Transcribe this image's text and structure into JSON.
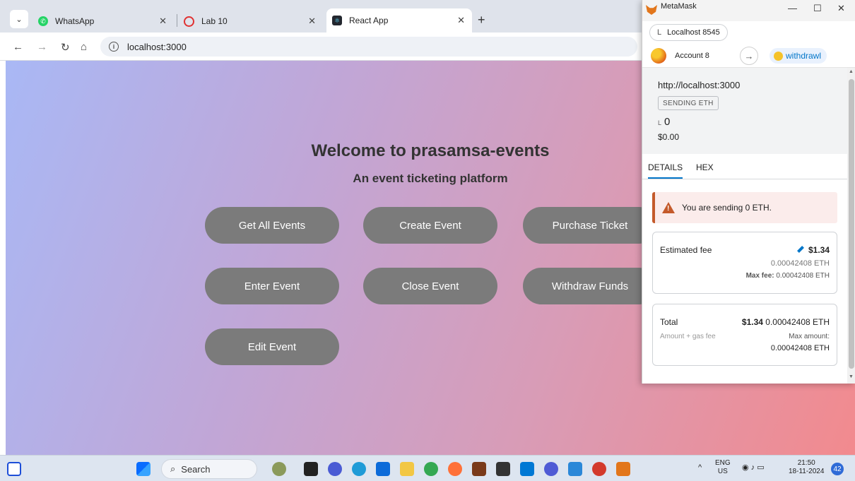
{
  "browser": {
    "tabs": [
      {
        "label": "WhatsApp",
        "icon": "whatsapp-icon"
      },
      {
        "label": "Lab 10",
        "icon": "lab-icon"
      },
      {
        "label": "React App",
        "icon": "react-icon"
      }
    ],
    "url": "localhost:3000"
  },
  "page": {
    "title": "Welcome to prasamsa-events",
    "subtitle": "An event ticketing platform",
    "buttons": [
      "Get All Events",
      "Create Event",
      "Purchase Ticket",
      "Enter Event",
      "Close Event",
      "Withdraw Funds",
      "Edit Event"
    ]
  },
  "metamask": {
    "window_title": "MetaMask",
    "network": "Localhost 8545",
    "network_prefix": "L",
    "account": "Account 8",
    "destination": "withdrawl",
    "origin": "http://localhost:3000",
    "badge": "SENDING ETH",
    "amount": "0",
    "amount_prefix": "L",
    "fiat": "$0.00",
    "tabs": [
      "DETAILS",
      "HEX"
    ],
    "warning": "You are sending 0 ETH.",
    "estimated_fee": {
      "label": "Estimated fee",
      "fiat": "$1.34",
      "eth": "0.00042408 ETH",
      "max_fee_label": "Max fee:",
      "max_fee": "0.00042408 ETH"
    },
    "total": {
      "label": "Total",
      "sub": "Amount + gas fee",
      "fiat": "$1.34",
      "eth": "0.00042408 ETH",
      "max_label": "Max amount:",
      "max": "0.00042408 ETH"
    }
  },
  "taskbar": {
    "search": "Search",
    "lang": "ENG",
    "region": "US",
    "time": "21:50",
    "date": "18-11-2024",
    "notifications": "42"
  }
}
